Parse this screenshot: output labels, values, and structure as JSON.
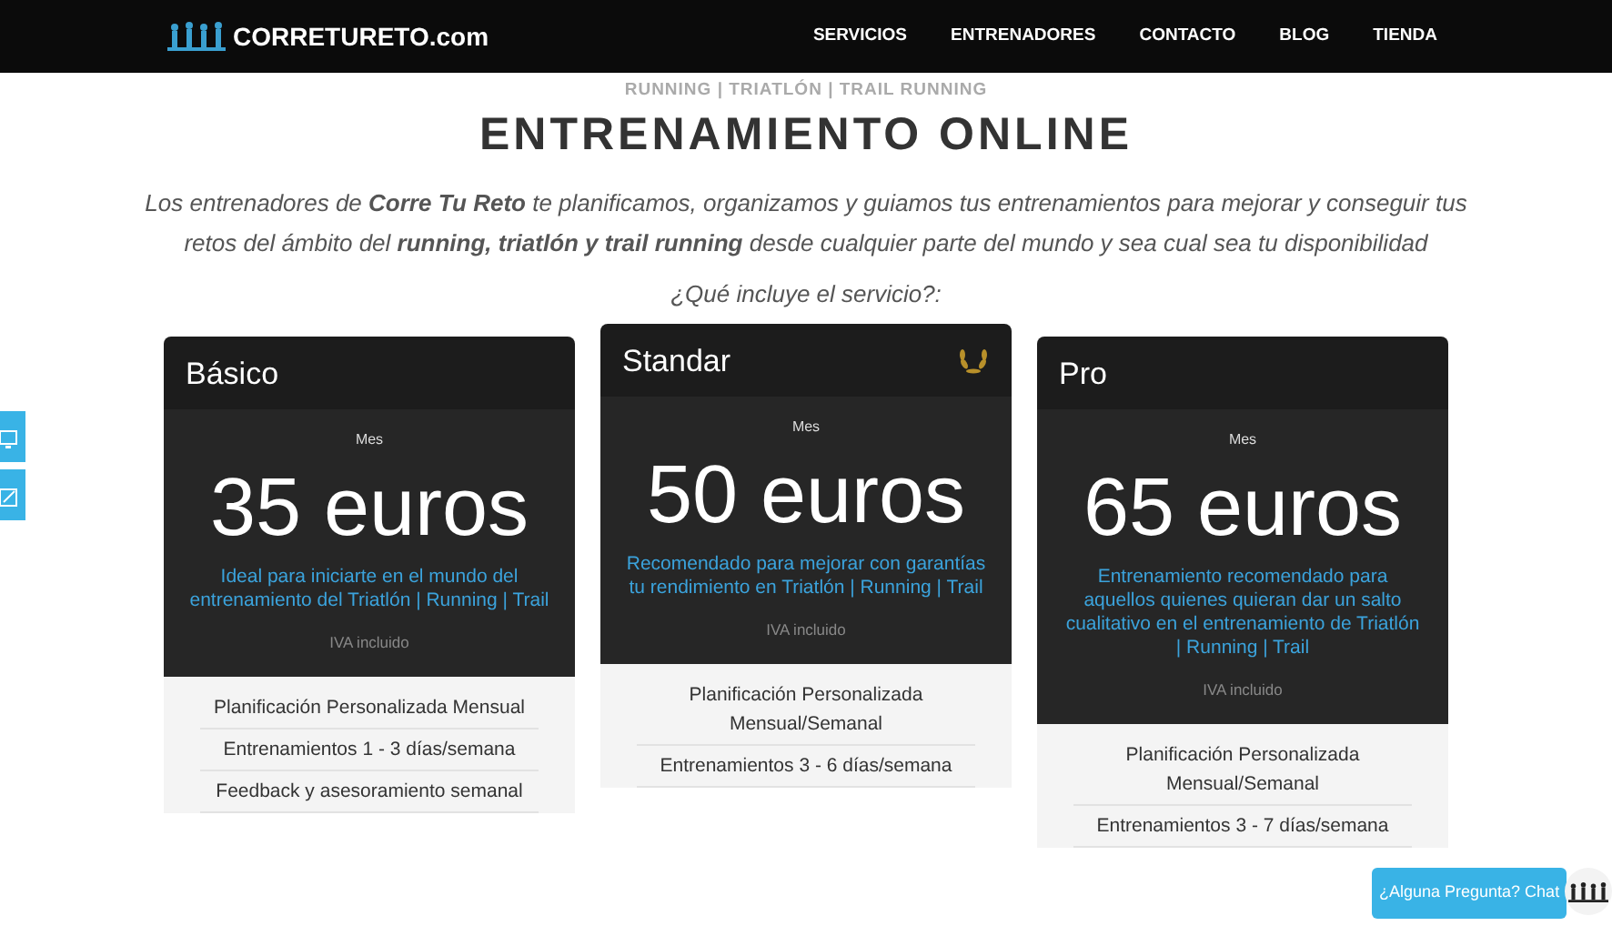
{
  "navbar": {
    "brand": "CORRETURETO.com",
    "links": [
      "SERVICIOS",
      "ENTRENADORES",
      "CONTACTO",
      "BLOG",
      "TIENDA"
    ]
  },
  "kicker": "RUNNING | TRIATLÓN | TRAIL RUNNING",
  "heading": "ENTRENAMIENTO ONLINE",
  "intro": "Los entrenadores de **Corre Tu Reto** te planificamos, organizamos y guiamos tus entrenamientos para mejorar y conseguir tus retos del ámbito del **running, triatlón y trail running** desde cualquier parte del mundo y sea cual sea tu disponibilidad",
  "question": "¿Qué incluye el servicio?:",
  "plans": [
    {
      "name": "Básico",
      "featured": false,
      "period": "Mes",
      "price": "35 euros",
      "description": "Ideal para iniciarte en el mundo del entrenamiento del Triatlón | Running | Trail",
      "tax_note": "IVA incluido",
      "features": [
        "Planificación Personalizada Mensual",
        "Entrenamientos 1 - 3 días/semana",
        "Feedback y asesoramiento semanal"
      ]
    },
    {
      "name": "Standar",
      "featured": true,
      "period": "Mes",
      "price": "50 euros",
      "description": "Recomendado para mejorar con garantías tu rendimiento en Triatlón | Running | Trail",
      "tax_note": "IVA incluido",
      "features": [
        "Planificación Personalizada Mensual/Semanal",
        "Entrenamientos 3 - 6 días/semana"
      ]
    },
    {
      "name": "Pro",
      "featured": false,
      "period": "Mes",
      "price": "65 euros",
      "description": "Entrenamiento recomendado para aquellos quienes quieran dar un salto cualitativo en el entrenamiento de Triatlón | Running | Trail",
      "tax_note": "IVA incluido",
      "features": [
        "Planificación Personalizada Mensual/Semanal",
        "Entrenamientos 3 - 7 días/semana"
      ]
    }
  ],
  "chat": {
    "label": "¿Alguna Pregunta? Chat"
  }
}
